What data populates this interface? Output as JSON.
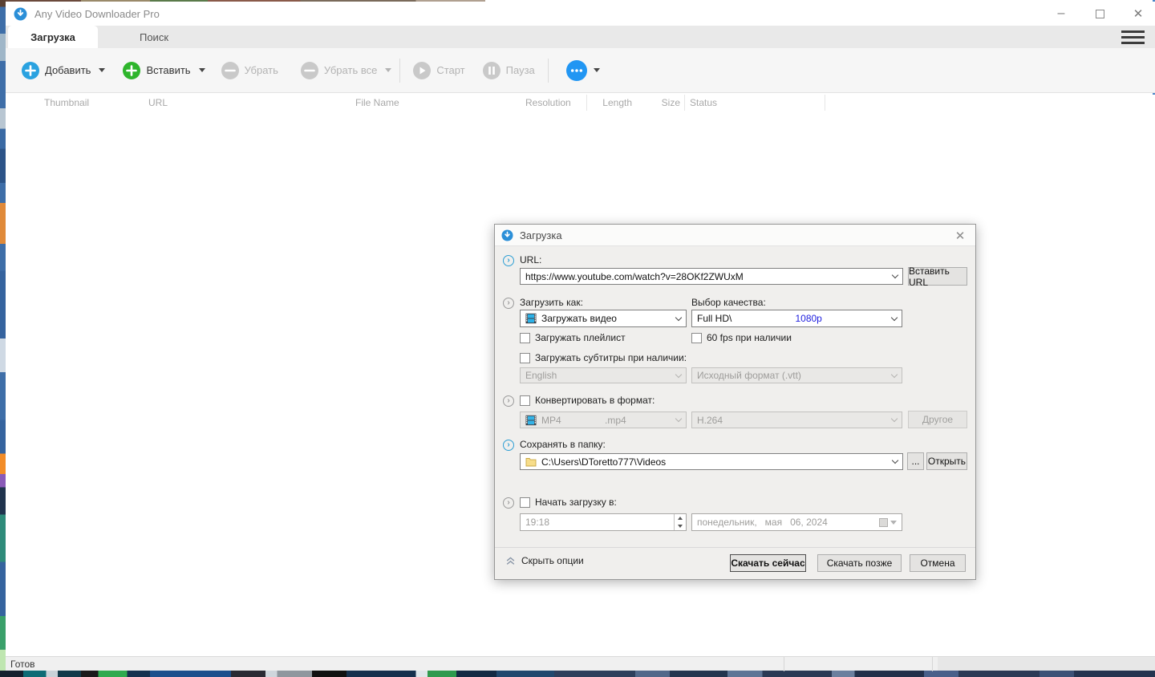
{
  "window": {
    "title": "Any Video Downloader Pro",
    "minimize": "–",
    "maximize": "",
    "close": "✕"
  },
  "tabs": {
    "download": "Загрузка",
    "search": "Поиск"
  },
  "toolbar": {
    "add": "Добавить",
    "paste": "Вставить",
    "remove": "Убрать",
    "remove_all": "Убрать все",
    "start": "Старт",
    "pause": "Пауза"
  },
  "table": {
    "columns": [
      "Thumbnail",
      "URL",
      "File Name",
      "Resolution",
      "Length",
      "Size",
      "Status"
    ]
  },
  "status_bar": {
    "text": "Готов"
  },
  "dialog": {
    "title": "Загрузка",
    "close": "✕",
    "url": {
      "label": "URL:",
      "value": "https://www.youtube.com/watch?v=28OKf2ZWUxM",
      "paste_button": "Вставить URL"
    },
    "download_as": {
      "label": "Загрузить как:",
      "value": "Загружать видео"
    },
    "quality": {
      "label": "Выбор качества:",
      "value": "Full HD\\",
      "selected": "1080p"
    },
    "playlist_checkbox": "Загружать плейлист",
    "fps_checkbox": "60 fps при наличии",
    "subtitles_checkbox": "Загружать субтитры при наличии:",
    "subtitle_language": "English",
    "subtitle_format": "Исходный формат (.vtt)",
    "convert": {
      "label": "Конвертировать в формат:",
      "format": "MP4",
      "extension": ".mp4",
      "codec": "H.264",
      "other_button": "Другое"
    },
    "save_folder": {
      "label": "Сохранять в папку:",
      "value": "C:\\Users\\DToretto777\\Videos",
      "browse_button": "...",
      "open_button": "Открыть"
    },
    "schedule": {
      "label": "Начать загрузку в:",
      "time": "19:18",
      "date": "понедельник,   мая   06, 2024"
    },
    "footer": {
      "hide_options": "Скрыть опции",
      "download_now": "Скачать сейчас",
      "download_later": "Скачать позже",
      "cancel": "Отмена"
    }
  },
  "colors": {
    "accent_blue": "#2aa2e0",
    "accent_green": "#2eb52c",
    "more_blue": "#2196f3",
    "quality_blue": "#2020df",
    "disabled_gray": "#c9c9c9"
  }
}
